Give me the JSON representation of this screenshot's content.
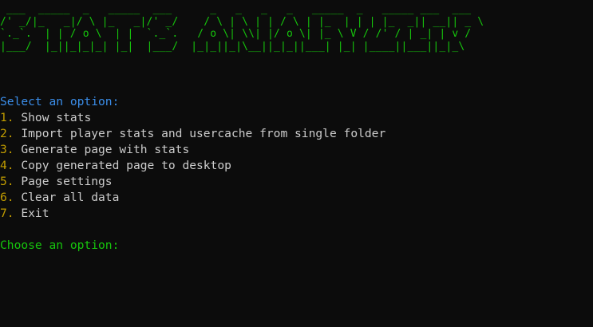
{
  "banner": {
    "lines": [
      " ___  _____  _   _____  ___      _   _   _   _   _____  _   _____ ___  ___ ",
      "/' _/|_   _|/ \\ |_   _|/' _/    / \\ | \\ | | / \\ | |_  | | | |_  _|| __|| _ \\",
      "`._`.  | | / o \\  | |  `._`.   / o \\| \\\\| |/ o \\| |_ \\ V / /' / | _| | v /",
      "|___/  |_||_|_|_| |_|  |___/  |_|_||_|\\__||_|_||___| |_| |____||___||_|_\\"
    ]
  },
  "menu": {
    "header": "Select an option:",
    "items": [
      {
        "number": "1.",
        "label": " Show stats"
      },
      {
        "number": "2.",
        "label": " Import player stats and usercache from single folder"
      },
      {
        "number": "3.",
        "label": " Generate page with stats"
      },
      {
        "number": "4.",
        "label": " Copy generated page to desktop"
      },
      {
        "number": "5.",
        "label": " Page settings"
      },
      {
        "number": "6.",
        "label": " Clear all data"
      },
      {
        "number": "7.",
        "label": " Exit"
      }
    ],
    "prompt": "Choose an option:"
  }
}
